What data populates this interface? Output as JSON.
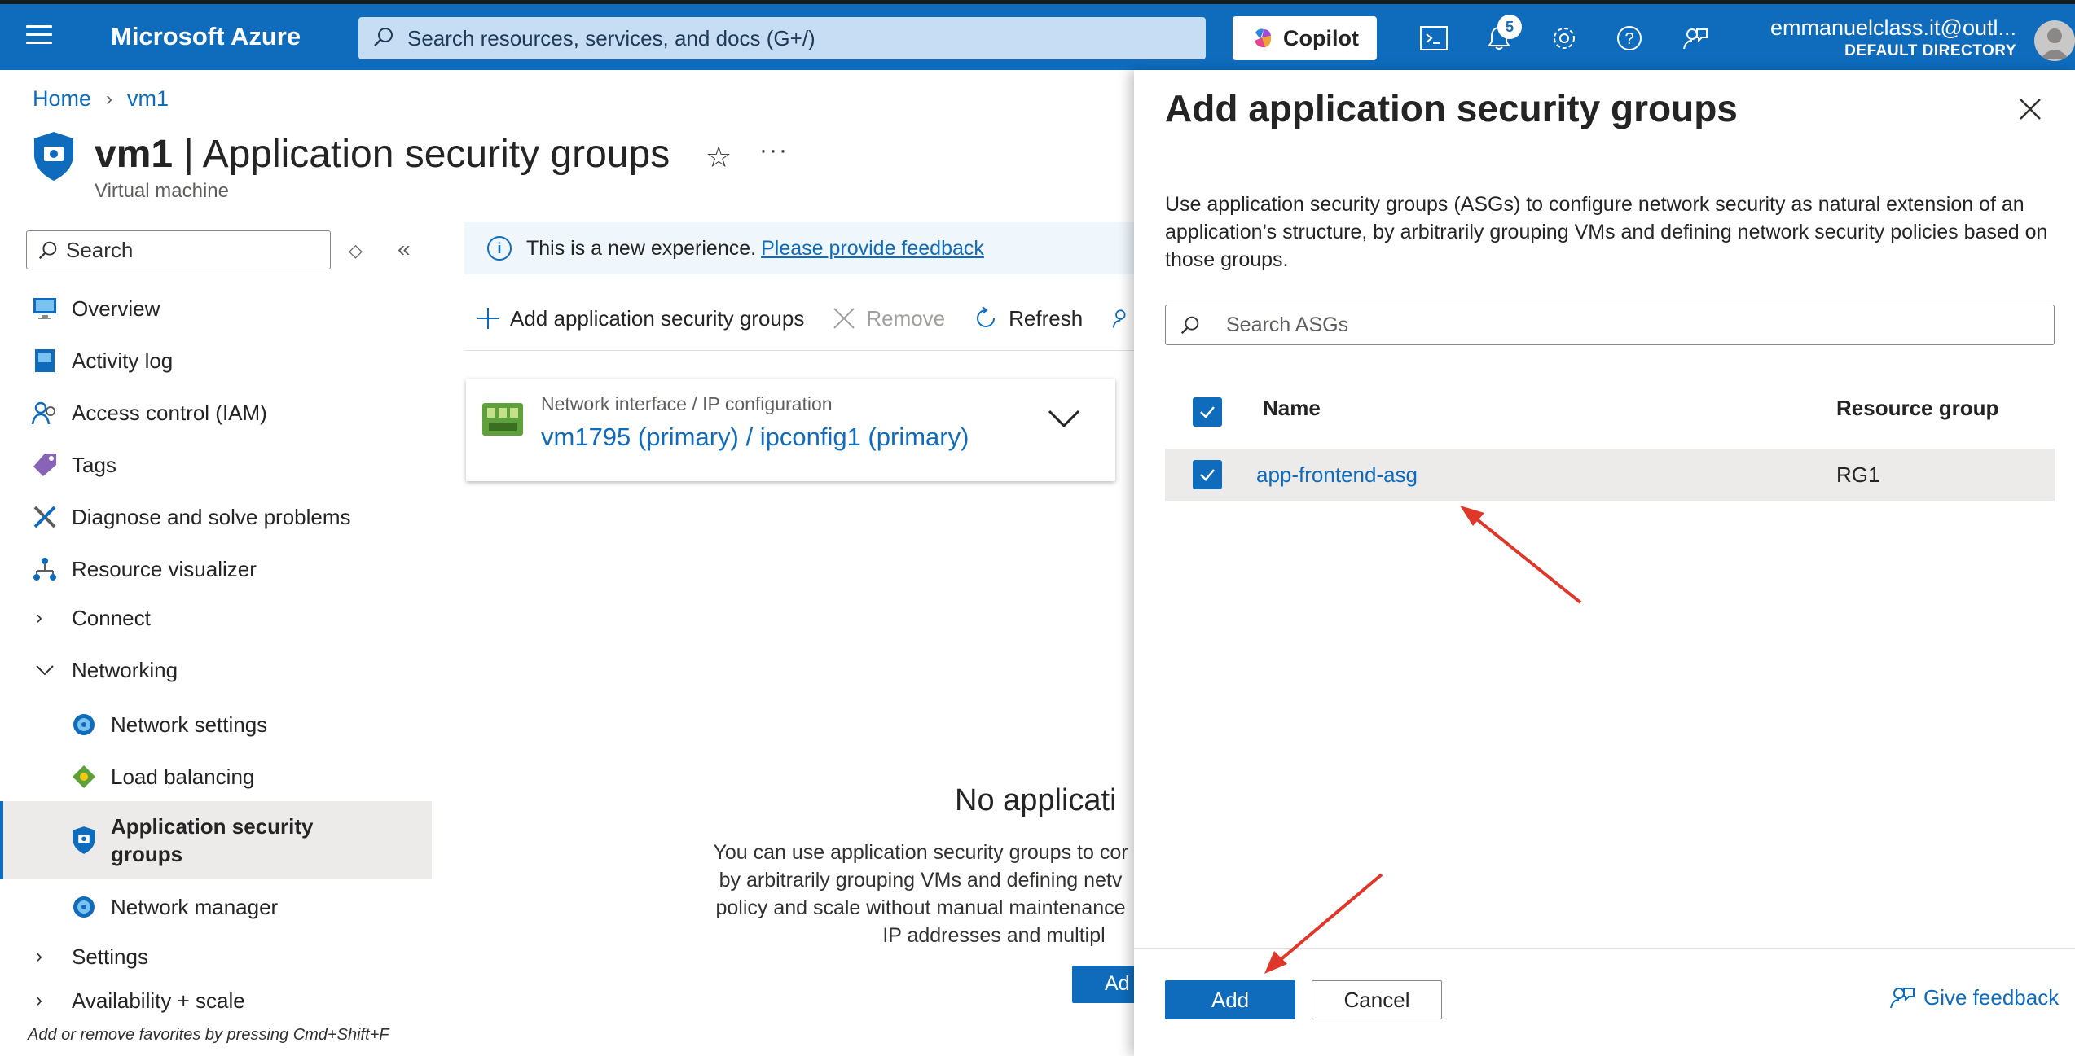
{
  "topbar": {
    "brand": "Microsoft Azure",
    "search_placeholder": "Search resources, services, and docs (G+/)",
    "copilot_label": "Copilot",
    "notification_count": "5",
    "account_email": "emmanuelclass.it@outl...",
    "account_directory": "DEFAULT DIRECTORY"
  },
  "breadcrumb": [
    "Home",
    "vm1"
  ],
  "page": {
    "title_bold": "vm1",
    "title_rest": " | Application security groups",
    "subtitle": "Virtual machine"
  },
  "sidebar": {
    "search_placeholder": "Search",
    "items": [
      {
        "label": "Overview",
        "icon": "monitor-icon"
      },
      {
        "label": "Activity log",
        "icon": "activity-log-icon"
      },
      {
        "label": "Access control (IAM)",
        "icon": "people-icon"
      },
      {
        "label": "Tags",
        "icon": "tag-icon"
      },
      {
        "label": "Diagnose and solve problems",
        "icon": "wrench-icon"
      },
      {
        "label": "Resource visualizer",
        "icon": "hierarchy-icon"
      },
      {
        "label": "Connect",
        "icon": "chevron-right-icon"
      },
      {
        "label": "Networking",
        "icon": "chevron-down-icon"
      },
      {
        "label": "Network settings",
        "icon": "network-globe-icon"
      },
      {
        "label": "Load balancing",
        "icon": "load-balancer-icon"
      },
      {
        "label": "Application security groups",
        "icon": "shield-icon"
      },
      {
        "label": "Network manager",
        "icon": "network-globe-icon"
      },
      {
        "label": "Settings",
        "icon": "chevron-right-icon"
      },
      {
        "label": "Availability + scale",
        "icon": "chevron-right-icon"
      }
    ],
    "footnote": "Add or remove favorites by pressing Cmd+Shift+F"
  },
  "content": {
    "info_text": "This is a new experience.",
    "info_link": "Please provide feedback",
    "toolbar": {
      "add": "Add application security groups",
      "remove": "Remove",
      "refresh": "Refresh"
    },
    "nic_label": "Network interface / IP configuration",
    "nic_value": "vm1795 (primary) / ipconfig1 (primary)",
    "empty_title": "No applicati",
    "empty_lines": [
      "You can use application security groups to cor",
      "by arbitrarily grouping VMs and defining netv",
      "policy and scale without manual maintenance",
      "IP addresses and multipl"
    ],
    "empty_button": "Ad"
  },
  "panel": {
    "title": "Add application security groups",
    "description": "Use application security groups (ASGs) to configure network security as natural extension of an application’s structure, by arbitrarily grouping VMs and defining network security policies based on those groups.",
    "search_placeholder": "Search ASGs",
    "columns": [
      "Name",
      "Resource group"
    ],
    "rows": [
      {
        "name": "app-frontend-asg",
        "resource_group": "RG1",
        "checked": true
      }
    ],
    "add_label": "Add",
    "cancel_label": "Cancel",
    "feedback_label": "Give feedback"
  },
  "colors": {
    "azure_blue": "#0f6cbd",
    "annotation_red": "#e0372b"
  }
}
